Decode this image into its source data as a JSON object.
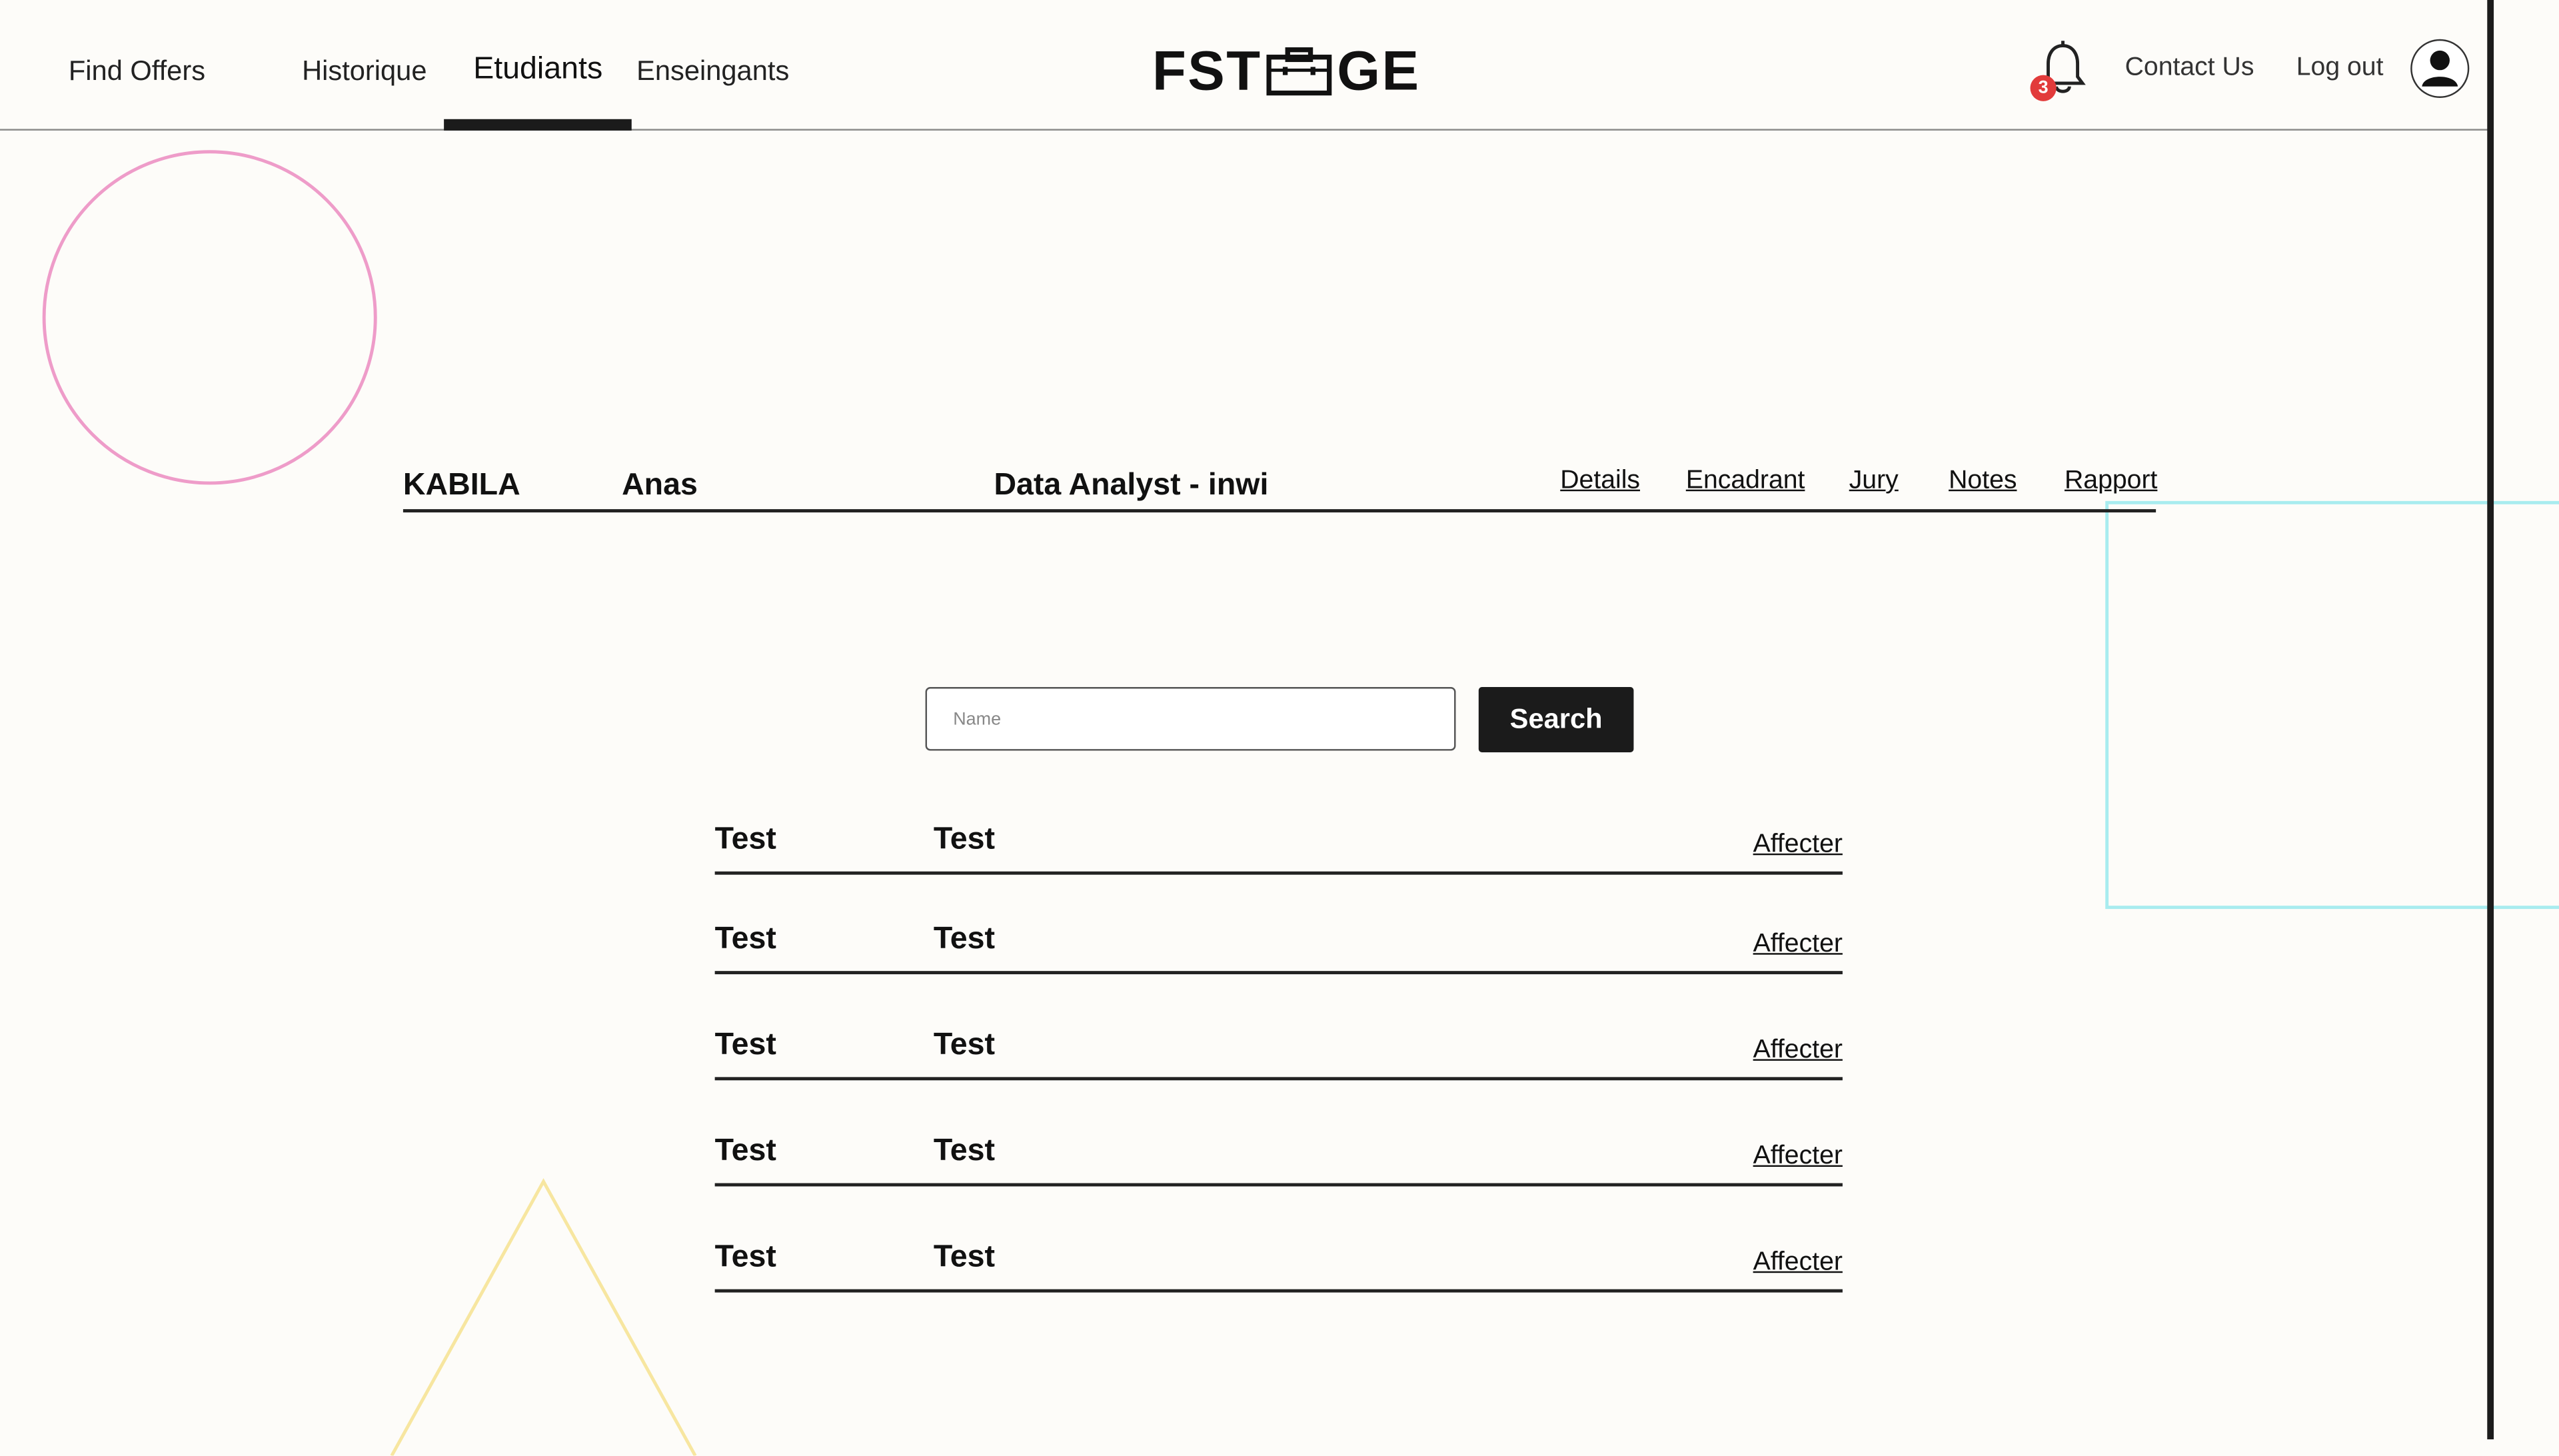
{
  "nav": {
    "find_offers": "Find Offers",
    "historique": "Historique",
    "etudiants": "Etudiants",
    "enseignants": "Enseingants"
  },
  "logo": {
    "left": "FST",
    "right": "GE"
  },
  "notifications": {
    "count": "3"
  },
  "header_links": {
    "contact": "Contact Us",
    "logout": "Log out"
  },
  "student": {
    "last_name": "KABILA",
    "first_name": "Anas",
    "position": "Data Analyst - inwi",
    "links": [
      "Details",
      "Encadrant",
      "Jury",
      "Notes",
      "Rapport"
    ]
  },
  "search": {
    "placeholder": "Name",
    "value": "",
    "button": "Search"
  },
  "rows": [
    {
      "col1": "Test",
      "col2": "Test",
      "action": "Affecter"
    },
    {
      "col1": "Test",
      "col2": "Test",
      "action": "Affecter"
    },
    {
      "col1": "Test",
      "col2": "Test",
      "action": "Affecter"
    },
    {
      "col1": "Test",
      "col2": "Test",
      "action": "Affecter"
    },
    {
      "col1": "Test",
      "col2": "Test",
      "action": "Affecter"
    }
  ],
  "colors": {
    "background": "#fdfcf9",
    "primary": "#1b1b1b",
    "badge": "#e23b3b",
    "circle": "#ee9cc9",
    "rectangle": "#a8ecef",
    "triangle": "#f7e6a0"
  },
  "icons": [
    "bell-icon",
    "briefcase-icon",
    "user-icon"
  ]
}
